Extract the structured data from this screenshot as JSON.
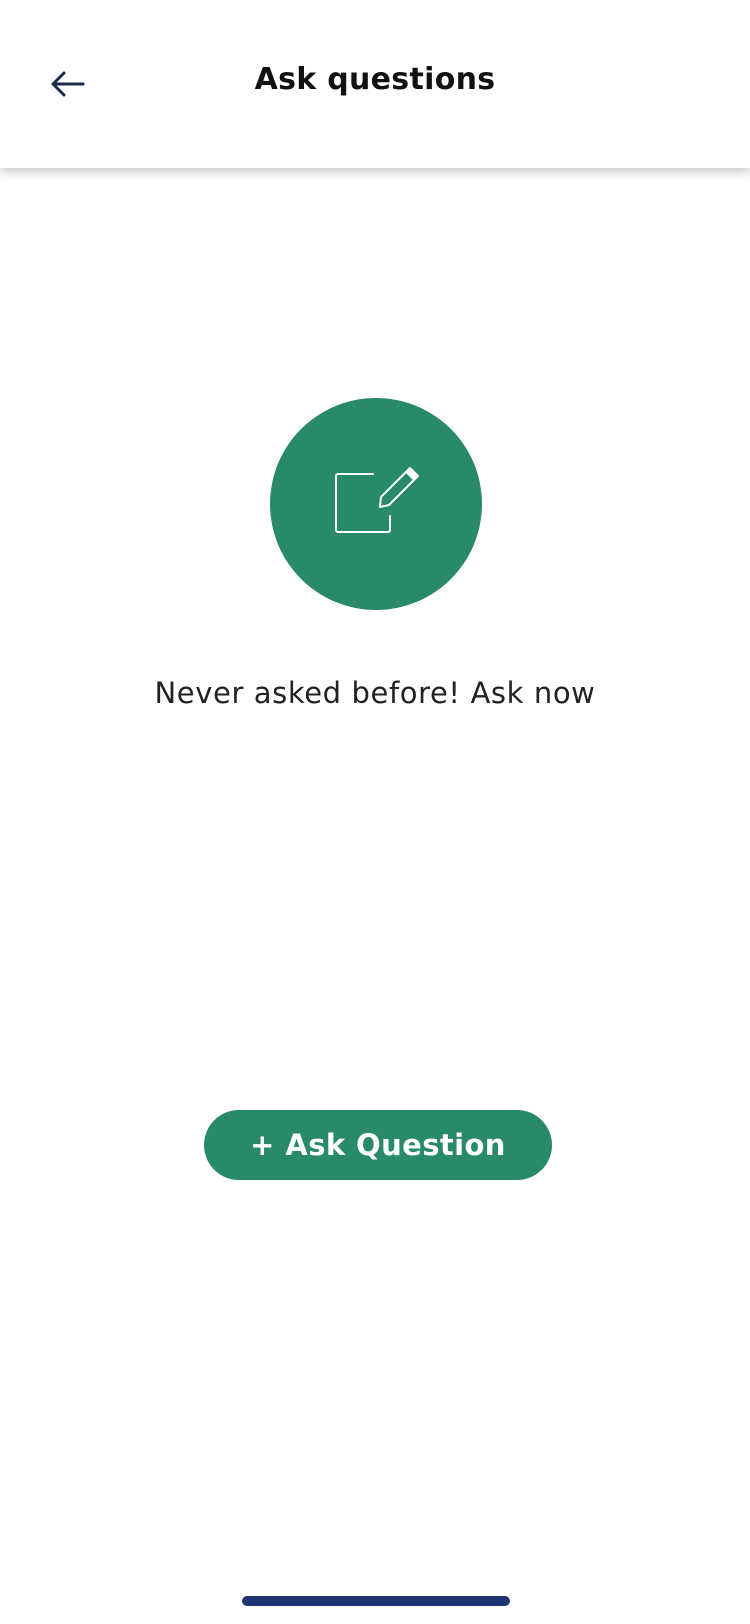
{
  "header": {
    "title": "Ask questions",
    "back_icon": "arrow-left-icon"
  },
  "empty_state": {
    "icon": "edit-icon",
    "message": "Never asked before! Ask now"
  },
  "actions": {
    "ask_question_label": "+ Ask Question"
  },
  "colors": {
    "accent": "#288A69",
    "title_text": "#111111",
    "back_icon": "#1E2A4A",
    "home_indicator": "#1F3575"
  }
}
